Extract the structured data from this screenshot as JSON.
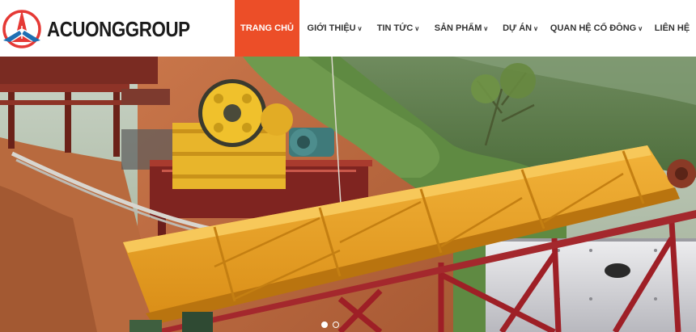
{
  "brand": {
    "name": "ACUONGGROUP",
    "colors": {
      "red": "#e53935",
      "blue": "#1e6fb3",
      "accent": "#ec4e28"
    }
  },
  "nav": {
    "items": [
      {
        "label": "TRANG CHỦ",
        "active": true,
        "dropdown": false
      },
      {
        "label": "GIỚI THIỆU",
        "active": false,
        "dropdown": true
      },
      {
        "label": "TIN TỨC",
        "active": false,
        "dropdown": true
      },
      {
        "label": "SẢN PHẨM",
        "active": false,
        "dropdown": true
      },
      {
        "label": "DỰ ÁN",
        "active": false,
        "dropdown": true
      },
      {
        "label": "QUAN HỆ CỔ ĐÔNG",
        "active": false,
        "dropdown": true
      },
      {
        "label": "LIÊN HỆ",
        "active": false,
        "dropdown": false
      }
    ]
  },
  "slider": {
    "image": "stone-crushing-plant-photo",
    "slide_count": 2,
    "active_slide": 1
  }
}
